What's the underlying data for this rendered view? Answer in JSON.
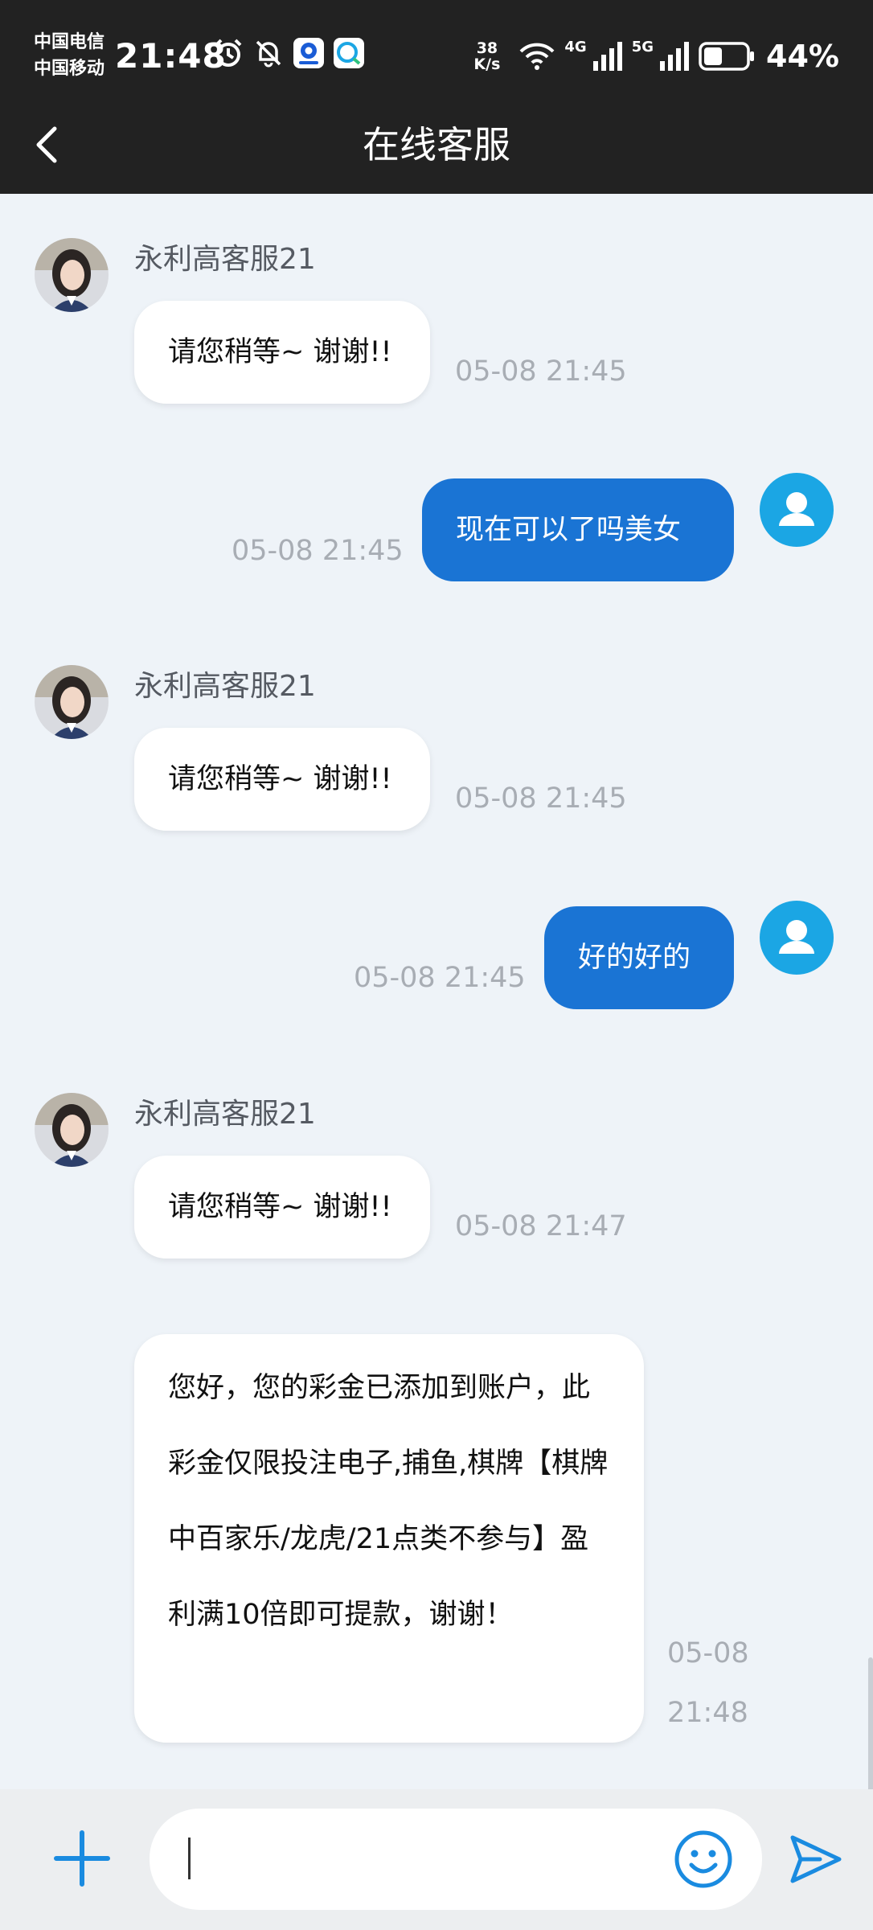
{
  "status_bar": {
    "carrier_1": "中国电信",
    "carrier_2": "中国移动",
    "time": "21:48",
    "net_speed_value": "38",
    "net_speed_unit": "K/s",
    "signal_1_label": "4G",
    "signal_2_label": "5G",
    "battery_percent": "44%",
    "battery_level": 0.44
  },
  "header": {
    "title": "在线客服"
  },
  "messages": [
    {
      "side": "in",
      "sender": "永利高客服21",
      "text": "请您稍等~ 谢谢!!",
      "time": "05-08 21:45"
    },
    {
      "side": "out",
      "text": "现在可以了吗美女",
      "time": "05-08 21:45"
    },
    {
      "side": "in",
      "sender": "永利高客服21",
      "text": "请您稍等~ 谢谢!!",
      "time": "05-08 21:45"
    },
    {
      "side": "out",
      "text": "好的好的",
      "time": "05-08 21:45"
    },
    {
      "side": "in",
      "sender": "永利高客服21",
      "text": "请您稍等~ 谢谢!!",
      "time": "05-08 21:47"
    },
    {
      "side": "in",
      "text": "您好，您的彩金已添加到账户，此彩金仅限投注电子,捕鱼,棋牌【棋牌中百家乐/龙虎/21点类不参与】盈利满10倍即可提款，谢谢！",
      "time": "05-08 21:48"
    }
  ],
  "input": {
    "placeholder": "",
    "value": ""
  },
  "colors": {
    "header_bg": "#222222",
    "outgoing_bubble": "#1a74d4",
    "accent": "#1a8be0"
  }
}
